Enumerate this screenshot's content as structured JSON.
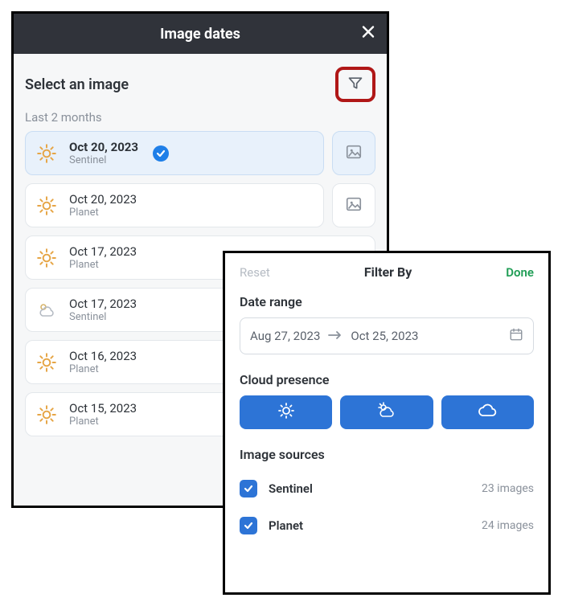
{
  "dates_panel": {
    "title": "Image dates",
    "select_label": "Select an image",
    "group_label": "Last 2 months",
    "rows": [
      {
        "date": "Oct 20, 2023",
        "source": "Sentinel",
        "weather": "sun",
        "selected": true,
        "thumb": true
      },
      {
        "date": "Oct 20, 2023",
        "source": "Planet",
        "weather": "sun",
        "selected": false,
        "thumb": true
      },
      {
        "date": "Oct 17, 2023",
        "source": "Planet",
        "weather": "sun",
        "selected": false,
        "thumb": false
      },
      {
        "date": "Oct 17, 2023",
        "source": "Sentinel",
        "weather": "part-cloud",
        "selected": false,
        "thumb": false
      },
      {
        "date": "Oct 16, 2023",
        "source": "Planet",
        "weather": "sun",
        "selected": false,
        "thumb": false
      },
      {
        "date": "Oct 15, 2023",
        "source": "Planet",
        "weather": "sun",
        "selected": false,
        "thumb": false
      }
    ]
  },
  "filter_panel": {
    "reset": "Reset",
    "title": "Filter By",
    "done": "Done",
    "date_range_label": "Date range",
    "date_from": "Aug 27, 2023",
    "date_to": "Oct 25, 2023",
    "cloud_label": "Cloud presence",
    "cloud_options": [
      "sun",
      "part-cloud",
      "cloud"
    ],
    "sources_label": "Image sources",
    "sources": [
      {
        "name": "Sentinel",
        "count": "23 images",
        "checked": true
      },
      {
        "name": "Planet",
        "count": "24 images",
        "checked": true
      }
    ]
  }
}
